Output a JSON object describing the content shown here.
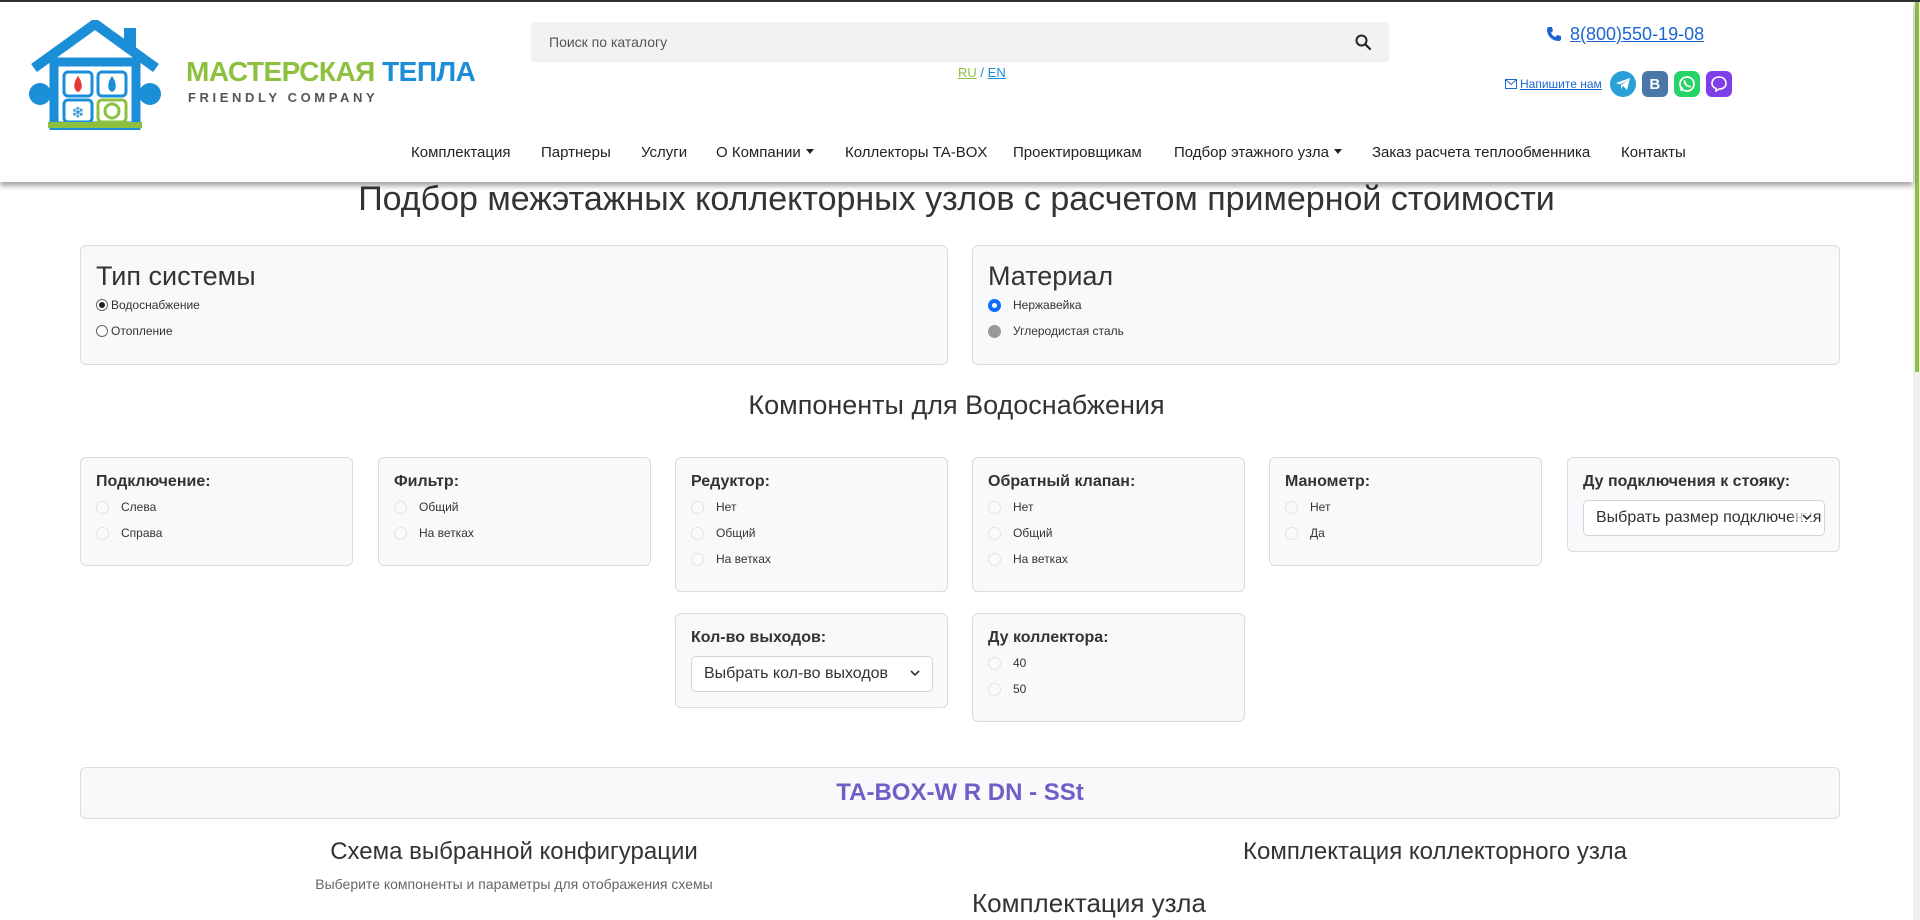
{
  "header": {
    "brand_part1": "МАСТЕРСКАЯ",
    "brand_part2": "ТЕПЛА",
    "brand_sub": "FRIENDLY COMPANY",
    "search_placeholder": "Поиск по каталогу",
    "lang_ru": "RU",
    "lang_sep": "/",
    "lang_en": "EN",
    "phone": "8(800)550-19-08",
    "write_us": "Напишите нам",
    "social": [
      "telegram",
      "vk",
      "whatsapp",
      "viber"
    ]
  },
  "nav": {
    "items": [
      {
        "label": "Комплектация",
        "dropdown": false
      },
      {
        "label": "Партнеры",
        "dropdown": false
      },
      {
        "label": "Услуги",
        "dropdown": false
      },
      {
        "label": "О Компании",
        "dropdown": true
      },
      {
        "label": "Коллекторы TA-BOX",
        "dropdown": false
      },
      {
        "label": "Проектировщикам",
        "dropdown": false
      },
      {
        "label": "Подбор этажного узла",
        "dropdown": true
      },
      {
        "label": "Заказ расчета теплообменника",
        "dropdown": false
      },
      {
        "label": "Контакты",
        "dropdown": false
      }
    ]
  },
  "main": {
    "title": "Подбор межэтажных коллекторных узлов с расчетом примерной стоимости",
    "system_type": {
      "title": "Тип системы",
      "options": [
        "Водоснабжение",
        "Отопление"
      ],
      "selected": 0
    },
    "material": {
      "title": "Материал",
      "options": [
        "Нержавейка",
        "Углеродистая сталь"
      ],
      "selected": 0
    },
    "components_title": "Компоненты для Водоснабжения",
    "components": {
      "connection": {
        "title": "Подключение:",
        "options": [
          "Слева",
          "Справа"
        ]
      },
      "filter": {
        "title": "Фильтр:",
        "options": [
          "Общий",
          "На ветках"
        ]
      },
      "reducer": {
        "title": "Редуктор:",
        "options": [
          "Нет",
          "Общий",
          "На ветках"
        ]
      },
      "check_valve": {
        "title": "Обратный клапан:",
        "options": [
          "Нет",
          "Общий",
          "На ветках"
        ]
      },
      "manometer": {
        "title": "Манометр:",
        "options": [
          "Нет",
          "Да"
        ]
      },
      "riser_dn": {
        "title": "Ду подключения к стояку:",
        "select": "Выбрать размер подключения"
      },
      "outlets": {
        "title": "Кол-во выходов:",
        "select": "Выбрать кол-во выходов"
      },
      "collector_dn": {
        "title": "Ду коллектора:",
        "options": [
          "40",
          "50"
        ]
      }
    },
    "model_code": "TA-BOX-W R DN - SSt",
    "scheme_title": "Схема выбранной конфигурации",
    "scheme_note": "Выберите компоненты и параметры для отображения схемы",
    "kit_title": "Комплектация коллекторного узла",
    "kit_subtitle": "Комплектация узла"
  },
  "colors": {
    "brand_green": "#8dc03f",
    "brand_blue": "#1b8ed8",
    "link_blue": "#1b66d1",
    "model_purple": "#6f5ec8",
    "radio_active": "#0d6efd"
  }
}
